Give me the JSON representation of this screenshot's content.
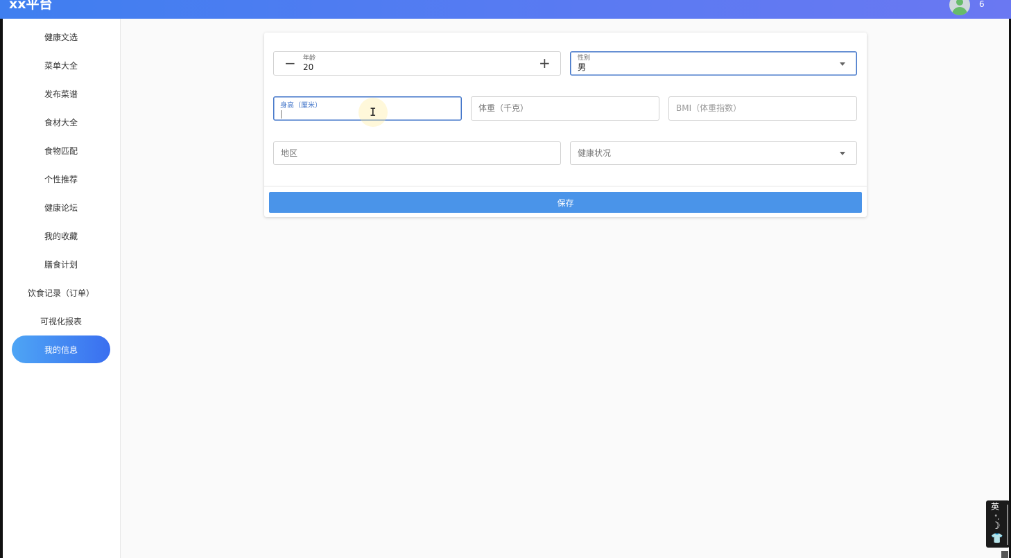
{
  "header": {
    "brand": "xx平台",
    "user_count": "6"
  },
  "sidebar": {
    "items": [
      {
        "label": "健康文选"
      },
      {
        "label": "菜单大全"
      },
      {
        "label": "发布菜谱"
      },
      {
        "label": "食材大全"
      },
      {
        "label": "食物匹配"
      },
      {
        "label": "个性推荐"
      },
      {
        "label": "健康论坛"
      },
      {
        "label": "我的收藏"
      },
      {
        "label": "膳食计划"
      },
      {
        "label": "饮食记录（订单）"
      },
      {
        "label": "可视化报表"
      },
      {
        "label": "我的信息",
        "active": true
      }
    ]
  },
  "form": {
    "age": {
      "label": "年龄",
      "value": "20",
      "decrement": "−",
      "increment": "+"
    },
    "gender": {
      "label": "性别",
      "value": "男"
    },
    "height": {
      "label": "身高（厘米）",
      "value": ""
    },
    "weight": {
      "placeholder": "体重（千克）"
    },
    "bmi": {
      "placeholder": "BMI（体重指数）"
    },
    "region": {
      "placeholder": "地区"
    },
    "health": {
      "placeholder": "健康状况"
    }
  },
  "actions": {
    "save_label": "保存"
  },
  "ime": {
    "mode_char": "英",
    "punct": "°,",
    "moon": "☽",
    "skin": "👕"
  },
  "colors": {
    "header_start": "#3f7ff0",
    "header_end": "#6a78f2",
    "active_nav_start": "#4ea5f5",
    "active_nav_end": "#3a6ff0",
    "save_button": "#4a94e9",
    "focus_border": "#3f73c8"
  }
}
